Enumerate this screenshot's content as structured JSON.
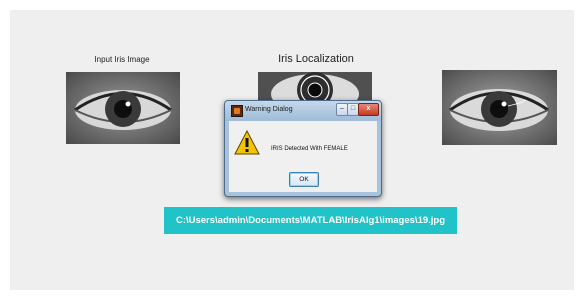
{
  "panels": {
    "left_title": "Input Iris Image",
    "middle_title": "Iris Localization"
  },
  "path_bar": {
    "text": "C:\\Users\\admin\\Documents\\MATLAB\\IrisAlg1\\images\\19.jpg",
    "color": "#21c3c8"
  },
  "dialog": {
    "title": "Warning Dialog",
    "message": "IRIS Detected With FEMALE",
    "ok_label": "OK",
    "icon": "warning-icon",
    "minimize_glyph": "–",
    "maximize_glyph": "□",
    "close_glyph": "x"
  }
}
